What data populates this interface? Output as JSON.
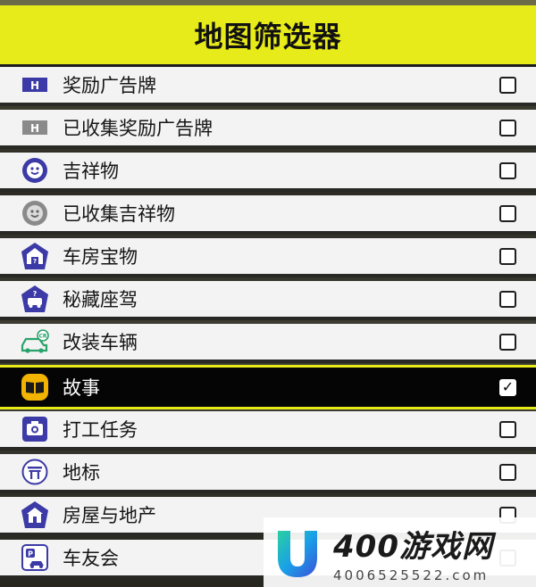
{
  "header": {
    "title": "地图筛选器"
  },
  "items": [
    {
      "label": "奖励广告牌",
      "icon": "billboard-icon",
      "checked": false,
      "checkmark": ""
    },
    {
      "label": "已收集奖励广告牌",
      "icon": "collected-billboard-icon",
      "checked": false,
      "checkmark": ""
    },
    {
      "label": "吉祥物",
      "icon": "mascot-icon",
      "checked": false,
      "checkmark": ""
    },
    {
      "label": "已收集吉祥物",
      "icon": "collected-mascot-icon",
      "checked": false,
      "checkmark": ""
    },
    {
      "label": "车房宝物",
      "icon": "barn-find-icon",
      "checked": false,
      "checkmark": ""
    },
    {
      "label": "秘藏座驾",
      "icon": "treasure-car-icon",
      "checked": false,
      "checkmark": ""
    },
    {
      "label": "改装车辆",
      "icon": "tuned-car-icon",
      "checked": false,
      "checkmark": ""
    },
    {
      "label": "故事",
      "icon": "story-book-icon",
      "checked": true,
      "checkmark": "✓"
    },
    {
      "label": "打工任务",
      "icon": "job-camera-icon",
      "checked": false,
      "checkmark": ""
    },
    {
      "label": "地标",
      "icon": "landmark-icon",
      "checked": false,
      "checkmark": ""
    },
    {
      "label": "房屋与地产",
      "icon": "house-icon",
      "checked": false,
      "checkmark": ""
    },
    {
      "label": "车友会",
      "icon": "car-club-icon",
      "checked": false,
      "checkmark": ""
    }
  ],
  "watermark": {
    "title": "400游戏网",
    "subtitle": "4006525522.com"
  },
  "colors": {
    "accent_yellow": "#e8eb1a",
    "icon_purple": "#3b3aa6",
    "icon_grey": "#8a8a8a",
    "story_gold": "#f2b400",
    "tuned_green": "#2aa36b"
  }
}
